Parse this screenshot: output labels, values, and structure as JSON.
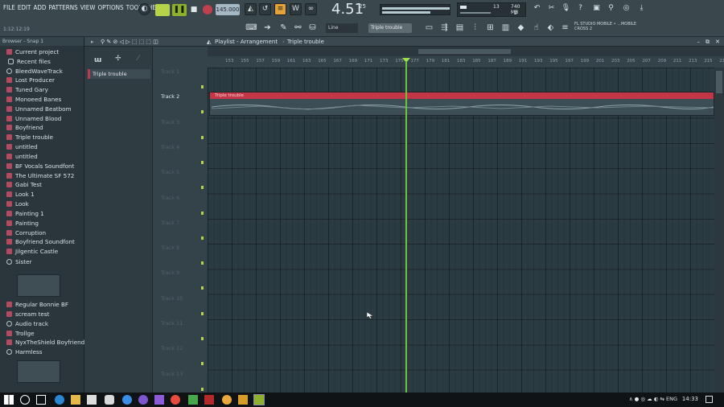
{
  "menu": [
    "FILE",
    "EDIT",
    "ADD",
    "PATTERNS",
    "VIEW",
    "OPTIONS",
    "TOOLS",
    "HELP"
  ],
  "hint": "1:12:12:19",
  "transport": {
    "tempo": "145.000",
    "time_big": "4.51",
    "time_small": "25"
  },
  "cpu": {
    "mem": "740 MB",
    "voices": "13",
    "poly": "2"
  },
  "line_select": "Line",
  "pattern_select": "Triple trouble",
  "news": "FL STUDIO MOBILE • ...MOBILE CROSS 2",
  "browser": {
    "header": "Browser - Snap 1",
    "items": [
      {
        "label": "Current project",
        "icon": "pink"
      },
      {
        "label": "Recent files",
        "icon": "folder"
      },
      {
        "label": "BleedWaveTrack",
        "icon": "circ"
      },
      {
        "label": "Lost Producer",
        "icon": "pink"
      },
      {
        "label": "Tuned Gary",
        "icon": "pink"
      },
      {
        "label": "Monoeed Banes",
        "icon": "pink"
      },
      {
        "label": "Unnamed Beatbom",
        "icon": "pink"
      },
      {
        "label": "Unnamed Blood",
        "icon": "pink"
      },
      {
        "label": "Boyfriend",
        "icon": "pink"
      },
      {
        "label": "Triple trouble",
        "icon": "pink"
      },
      {
        "label": "untitled",
        "icon": "pink"
      },
      {
        "label": "untitled",
        "icon": "pink"
      },
      {
        "label": "BF Vocals Soundfont",
        "icon": "pink"
      },
      {
        "label": "The Ultimate SF 572",
        "icon": "pink"
      },
      {
        "label": "Gabi Test",
        "icon": "pink"
      },
      {
        "label": "Look 1",
        "icon": "pink"
      },
      {
        "label": "Look",
        "icon": "pink"
      },
      {
        "label": "Painting 1",
        "icon": "pink"
      },
      {
        "label": "Painting",
        "icon": "pink"
      },
      {
        "label": "Corruption",
        "icon": "pink"
      },
      {
        "label": "Boyfriend Soundfont",
        "icon": "pink"
      },
      {
        "label": "Jilgentic Castle",
        "icon": "pink"
      },
      {
        "label": "Sister",
        "icon": "circ"
      },
      {
        "label": "Regular Bonnie BF",
        "icon": "pink"
      },
      {
        "label": "scream test",
        "icon": "pink"
      },
      {
        "label": "Audio track",
        "icon": "circ"
      },
      {
        "label": "Trollge",
        "icon": "pink"
      },
      {
        "label": "NyxTheShield Boyfriend",
        "icon": "pink"
      },
      {
        "label": "Harmless",
        "icon": "circ"
      }
    ]
  },
  "playlist": {
    "title": "Playlist - Arrangement",
    "pattern": "Triple trouble",
    "picker_item": "Triple trouble",
    "tracks": [
      "Track 1",
      "Track 2",
      "Track 3",
      "Track 4",
      "Track 5",
      "Track 6",
      "Track 7",
      "Track 8",
      "Track 9",
      "Track 10",
      "Track 11",
      "Track 12",
      "Track 13"
    ],
    "active_track": "Track 2",
    "clip_name": "Triple trouble",
    "ticks": [
      "153",
      "155",
      "157",
      "159",
      "161",
      "163",
      "165",
      "167",
      "169",
      "171",
      "173",
      "175",
      "177",
      "179",
      "181",
      "183",
      "185",
      "187",
      "189",
      "191",
      "193",
      "195",
      "197",
      "199",
      "201",
      "203",
      "205",
      "207",
      "209",
      "211",
      "213",
      "215",
      "217"
    ]
  },
  "taskbar": {
    "lang": "ENG",
    "time": "14:33"
  },
  "colors": {
    "accent": "#b7d34a",
    "clip": "#c23647",
    "playhead": "#6cc43a"
  }
}
